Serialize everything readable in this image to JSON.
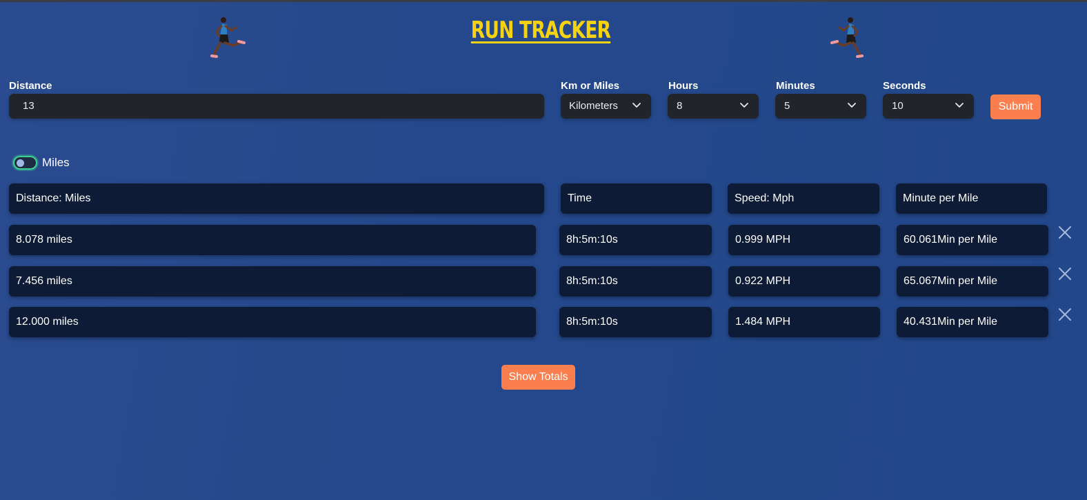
{
  "app": {
    "title": "RUN TRACKER"
  },
  "form": {
    "distance_label": "Distance",
    "distance_value": "13",
    "unit_label": "Km or Miles",
    "unit_value": "Kilometers",
    "hours_label": "Hours",
    "hours_value": "8",
    "minutes_label": "Minutes",
    "minutes_value": "5",
    "seconds_label": "Seconds",
    "seconds_value": "10",
    "submit_label": "Submit"
  },
  "toggle": {
    "label": "Miles",
    "checked": false
  },
  "table": {
    "headers": [
      "Distance: Miles",
      "Time",
      "Speed: Mph",
      "Minute per Mile"
    ],
    "rows": [
      {
        "distance": "8.078 miles",
        "time": "8h:5m:10s",
        "speed": "0.999 MPH",
        "pace": "60.061Min per Mile"
      },
      {
        "distance": "7.456 miles",
        "time": "8h:5m:10s",
        "speed": "0.922 MPH",
        "pace": "65.067Min per Mile"
      },
      {
        "distance": "12.000 miles",
        "time": "8h:5m:10s",
        "speed": "1.484 MPH",
        "pace": "40.431Min per Mile"
      }
    ]
  },
  "actions": {
    "show_totals_label": "Show Totals"
  },
  "colors": {
    "background": "#24488b",
    "title": "#f6d20f",
    "accent_button": "#fb7e4f",
    "cell": "#0e1b36",
    "input": "#212429",
    "toggle_border": "#3fd18f"
  },
  "icons": [
    "runner-icon",
    "chevron-down-icon",
    "close-icon"
  ]
}
